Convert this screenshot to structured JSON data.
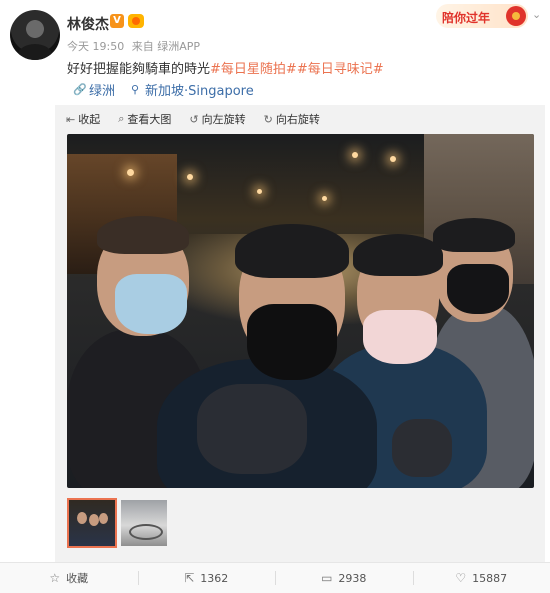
{
  "header": {
    "username": "林俊杰",
    "verify_mark": "V",
    "meta": {
      "time": "今天 19:50",
      "source": "来自 绿洲APP"
    },
    "promo_text": "陪你过年",
    "menu_glyph": "⌄"
  },
  "post": {
    "text": "好好把握能夠騎車的時光",
    "tag1": "#每日星随拍#",
    "tag2": "#每日寻味记#",
    "chips": [
      {
        "icon": "link-icon",
        "glyph": "🔗",
        "label": "绿洲"
      },
      {
        "icon": "location-pin-icon",
        "glyph": "⚲",
        "label": "新加坡·Singapore"
      }
    ]
  },
  "toolbar": {
    "collapse": "收起",
    "view_large": "查看大图",
    "rotate_left": "向左旋转",
    "rotate_right": "向右旋转"
  },
  "footer": {
    "favorite": "收藏",
    "reposts": "1362",
    "comments": "2938",
    "likes": "15887"
  },
  "colors": {
    "accent": "#eb7350",
    "link": "#3d6ea8",
    "badge": "#f7931a",
    "promo_red": "#e0332b"
  }
}
